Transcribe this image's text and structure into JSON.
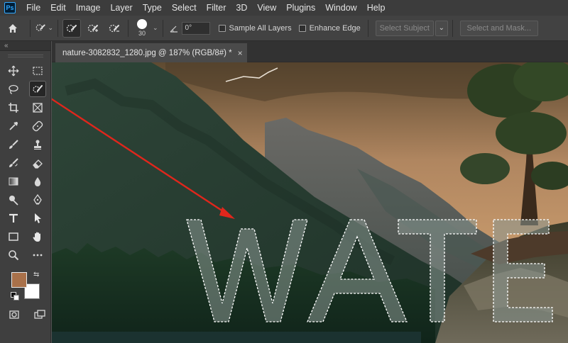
{
  "app": {
    "logo": "Ps",
    "menu": [
      "File",
      "Edit",
      "Image",
      "Layer",
      "Type",
      "Select",
      "Filter",
      "3D",
      "View",
      "Plugins",
      "Window",
      "Help"
    ]
  },
  "options_bar": {
    "brush_size": "30",
    "angle": "0°",
    "sample_all_layers": {
      "label": "Sample All Layers",
      "checked": false
    },
    "enhance_edge": {
      "label": "Enhance Edge",
      "checked": false
    },
    "select_subject_label": "Select Subject",
    "select_and_mask_label": "Select and Mask..."
  },
  "tools_panel": {
    "collapse_glyph": "«",
    "active_tool": "quick-selection-tool",
    "foreground_color": "#a9714a",
    "background_color": "#ffffff",
    "tools": [
      "move-tool",
      "rectangular-marquee-tool",
      "lasso-tool",
      "quick-selection-tool",
      "crop-tool",
      "frame-tool",
      "eyedropper-tool",
      "spot-healing-brush-tool",
      "brush-tool",
      "clone-stamp-tool",
      "history-brush-tool",
      "eraser-tool",
      "gradient-tool",
      "blur-tool",
      "dodge-tool",
      "pen-tool",
      "type-tool",
      "path-selection-tool",
      "rectangle-tool",
      "hand-tool",
      "zoom-tool",
      "more-tools"
    ]
  },
  "document": {
    "tab_title": "nature-3082832_1280.jpg @ 187% (RGB/8#) *",
    "close_glyph": "×",
    "watermark_text": "WATE"
  },
  "annotation": {
    "arrow_color": "#e0261c"
  }
}
